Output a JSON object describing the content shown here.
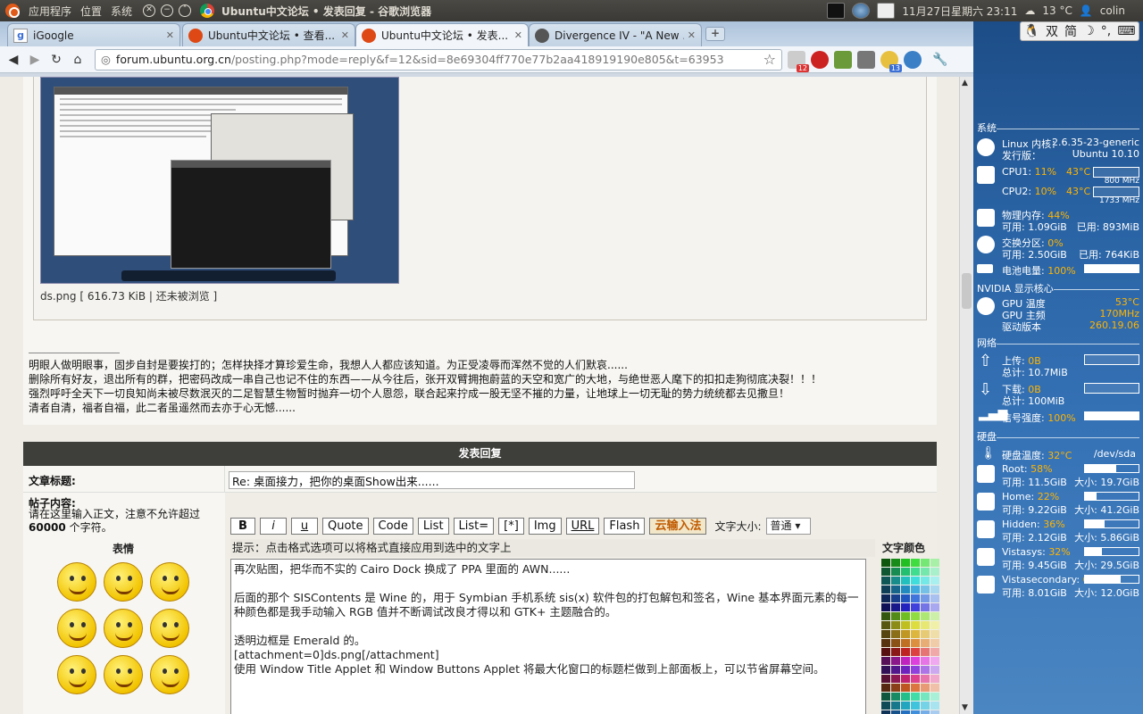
{
  "top_panel": {
    "menu_apps": "应用程序",
    "menu_places": "位置",
    "menu_system": "系统",
    "window_title": "Ubuntu中文论坛 • 发表回复 - 谷歌浏览器",
    "datetime": "11月27日星期六 23:11",
    "temperature": "13 °C",
    "user": "colin"
  },
  "tabs": [
    {
      "label": "iGoogle",
      "icon": "google-icon"
    },
    {
      "label": "Ubuntu中文论坛 • 查看...",
      "icon": "ubuntu-icon"
    },
    {
      "label": "Ubuntu中文论坛 • 发表...",
      "icon": "ubuntu-icon"
    },
    {
      "label": "Divergence IV - \"A New ...",
      "icon": "divergence-icon"
    }
  ],
  "omnibox": {
    "host": "forum.ubuntu.org.cn",
    "path": "/posting.php?mode=reply&f=12&sid=8e69304ff770e77b2aa418919190e805&t=63953"
  },
  "extensions": {
    "mail_badge": "12",
    "weather_badge": "13"
  },
  "attachment": {
    "caption": "ds.png [ 616.73 KiB | 还未被浏览 ]"
  },
  "signature": [
    "明眼人做明眼事，固步自封是要挨打的；怎样抉择才算珍爱生命，我想人人都应该知道。为正受凌辱而浑然不觉的人们默哀......",
    "删除所有好友，退出所有的群，把密码改成一串自己也记不住的东西——从今往后，张开双臂拥抱蔚蓝的天空和宽广的大地，与绝世恶人麾下的扣扣走狗彻底决裂！！！",
    "强烈呼吁全天下一切良知尚未被尽数泯灭的二足智慧生物暂时抛弃一切个人恩怨，联合起来拧成一股无坚不摧的力量，让地球上一切无耻的势力统统都去见撒旦！",
    "清者自清，福者自福，此二者虽遥然而去亦于心无憾......"
  ],
  "reply_form": {
    "header": "发表回复",
    "subject_label": "文章标题:",
    "subject_value": "Re: 桌面接力，把你的桌面Show出来......",
    "content_label": "帖子内容:",
    "content_hint_1": "请在这里输入正文，注意不允许超过",
    "content_hint_limit": "60000",
    "content_hint_2": " 个字符。",
    "emoticons_label": "表情",
    "buttons": [
      "B",
      "i",
      "u",
      "Quote",
      "Code",
      "List",
      "List=",
      "[*]",
      "Img",
      "URL",
      "Flash",
      "云输入法"
    ],
    "font_size_label": "文字大小:",
    "font_size_value": "普通",
    "hint": "提示：点击格式选项可以将格式直接应用到选中的文字上",
    "color_label": "文字颜色",
    "body": "再次贴图，把华而不实的 Cairo Dock 换成了 PPA 里面的 AWN......\n\n后面的那个 SISContents 是 Wine 的，用于 Symbian 手机系统 sis(x) 软件包的打包解包和签名，Wine 基本界面元素的每一种颜色都是我手动输入 RGB 值并不断调试改良才得以和 GTK+ 主题融合的。\n\n透明边框是 Emerald 的。\n[attachment=0]ds.png[/attachment]\n使用 Window Title Applet 和 Window Buttons Applet 将最大化窗口的标题栏做到上部面板上，可以节省屏幕空间。"
  },
  "conky": {
    "ime": [
      "双",
      "简"
    ],
    "system_header": "系统",
    "kernel_label": "Linux 内核：",
    "kernel_value": "2.6.35-23-generic",
    "distro_label": "发行版：",
    "distro_value": "Ubuntu 10.10",
    "cpu1_label": "CPU1:",
    "cpu1_usage": "11%",
    "cpu1_temp": "43°C",
    "cpu1_freq": "800 MHz",
    "cpu2_label": "CPU2:",
    "cpu2_usage": "10%",
    "cpu2_temp": "43°C",
    "cpu2_freq": "1733 MHz",
    "mem_label": "物理内存:",
    "mem_pct": "44%",
    "mem_free": "可用: 1.09GiB",
    "mem_used": "已用: 893MiB",
    "swap_label": "交换分区:",
    "swap_pct": "0%",
    "swap_free": "可用: 2.50GiB",
    "swap_used": "已用: 764KiB",
    "battery_label": "电池电量:",
    "battery_pct": "100%",
    "nvidia_header": "NVIDIA 显示核心",
    "gpu_temp_label": "GPU 温度",
    "gpu_temp": "53°C",
    "gpu_freq_label": "GPU 主频",
    "gpu_freq": "170MHz",
    "driver_label": "驱动版本",
    "driver_value": "260.19.06",
    "net_header": "网络",
    "up_label": "上传:",
    "up_value": "0B",
    "up_total": "总计: 10.7MiB",
    "down_label": "下载:",
    "down_value": "0B",
    "down_total": "总计: 100MiB",
    "signal_label": "信号强度:",
    "signal_value": "100%",
    "disk_header": "硬盘",
    "disk_temp_label": "硬盘温度:",
    "disk_temp": "32°C",
    "disk_dev": "/dev/sda",
    "disks": [
      {
        "name": "Root:",
        "pct": "58%",
        "free": "可用: 11.5GiB",
        "size": "大小: 19.7GiB",
        "fill": 0.58
      },
      {
        "name": "Home:",
        "pct": "22%",
        "free": "可用: 9.22GiB",
        "size": "大小: 41.2GiB",
        "fill": 0.22
      },
      {
        "name": "Hidden:",
        "pct": "36%",
        "free": "可用: 2.12GiB",
        "size": "大小: 5.86GiB",
        "fill": 0.36
      },
      {
        "name": "Vistasys:",
        "pct": "32%",
        "free": "可用: 9.45GiB",
        "size": "大小: 29.5GiB",
        "fill": 0.32
      },
      {
        "name": "Vistasecondary:",
        "pct": "66%",
        "free": "可用: 8.01GiB",
        "size": "大小: 12.0GiB",
        "fill": 0.66
      }
    ]
  }
}
